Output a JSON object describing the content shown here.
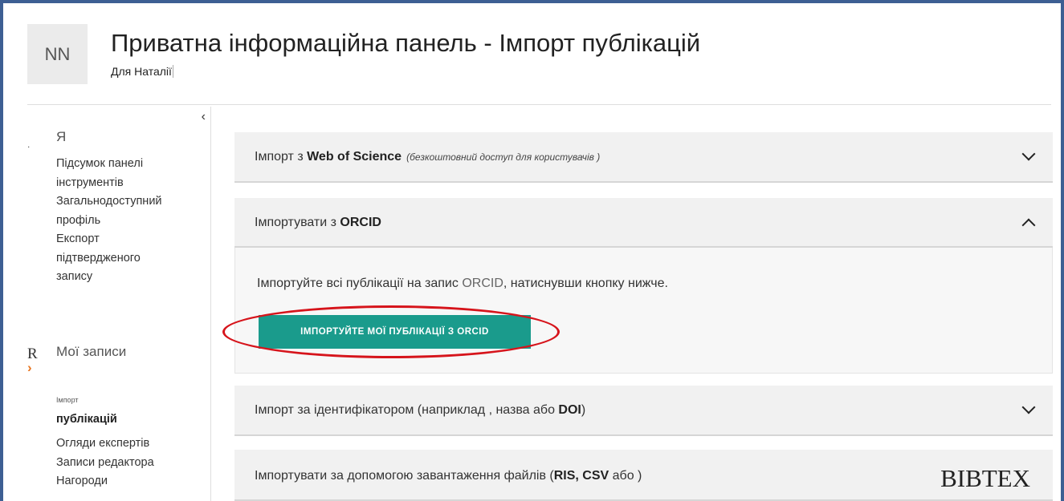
{
  "header": {
    "avatar_initials": "NN",
    "title": "Приватна інформаційна панель - Імпорт публікацій",
    "subtitle": "Для Наталії"
  },
  "sidebar": {
    "collapse_icon": "‹",
    "dot": ".",
    "section_me": "Я",
    "me_items": [
      {
        "label": "Підсумок панелі"
      },
      {
        "label": "інструментів"
      },
      {
        "label": "Загальнодоступний"
      },
      {
        "label": "профіль"
      },
      {
        "label": "Експорт"
      },
      {
        "label": "підтвердженого"
      },
      {
        "label": "запису"
      }
    ],
    "r_mark": "R",
    "section_records": "Мої записи",
    "arrow_icon": "›",
    "active_small": "Імпорт",
    "active_label": "публікацій",
    "records_items": [
      {
        "label": "Огляди експертів"
      },
      {
        "label": "Записи редактора"
      },
      {
        "label": "Нагороди"
      }
    ]
  },
  "accordions": {
    "wos": {
      "prefix": "Імпорт з ",
      "bold": "Web of Science",
      "note": "(безкоштовний доступ для користувачів )"
    },
    "orcid": {
      "prefix": "Імпортувати з ",
      "bold": "ORCID",
      "body_prefix": "Імпортуйте всі публікації на запис ",
      "body_orcid": "ORCID",
      "body_suffix": ", натиснувши кнопку нижче.",
      "button_label": "ІМПОРТУЙТЕ МОЇ ПУБЛІКАЦІЇ З ORCID"
    },
    "identifier": {
      "prefix": "Імпорт за ідентифікатором (наприклад , назва або ",
      "bold": "DOI",
      "suffix": ")"
    },
    "file": {
      "prefix": "Імпортувати за допомогою завантаження файлів (",
      "bold": "RIS, CSV",
      "suffix": " або )",
      "bibtex": "BIBTEX"
    }
  },
  "colors": {
    "frame": "#3d5f93",
    "button": "#1a9b8c",
    "highlight": "#d6141b",
    "accent_arrow": "#e87722"
  }
}
